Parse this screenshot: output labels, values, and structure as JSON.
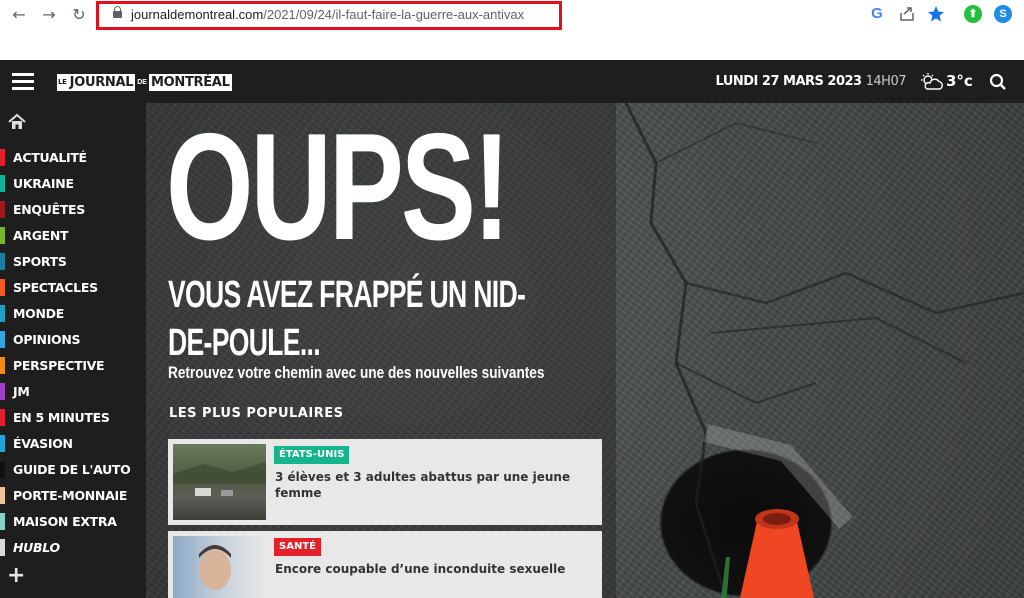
{
  "browser": {
    "url_domain": "journaldemontreal.com",
    "url_path": "/2021/09/24/il-faut-faire-la-guerre-aux-antivax"
  },
  "header": {
    "logo_le": "LE",
    "logo_journal": "JOURNAL",
    "logo_de": "DE",
    "logo_montreal": "MONTRÉAL",
    "date": "LUNDI 27 MARS 2023",
    "time": "14H07",
    "temperature": "3°c"
  },
  "sidebar": {
    "items": [
      {
        "label": "ACTUALITÉ",
        "color": "#e4202a"
      },
      {
        "label": "UKRAINE",
        "color": "#0fb49a"
      },
      {
        "label": "ENQUÊTES",
        "color": "#9b1b1f"
      },
      {
        "label": "ARGENT",
        "color": "#7bb52a"
      },
      {
        "label": "SPORTS",
        "color": "#1a7fa6"
      },
      {
        "label": "SPECTACLES",
        "color": "#f25c20"
      },
      {
        "label": "MONDE",
        "color": "#1da0c8"
      },
      {
        "label": "OPINIONS",
        "color": "#31a8e0"
      },
      {
        "label": "PERSPECTIVE",
        "color": "#f28a1a"
      },
      {
        "label": "JM",
        "color": "#a040c8"
      },
      {
        "label": "EN 5 MINUTES",
        "color": "#e4202a"
      },
      {
        "label": "ÉVASION",
        "color": "#1fa6d8"
      },
      {
        "label": "GUIDE DE L'AUTO",
        "color": "#111111"
      },
      {
        "label": "PORTE-MONNAIE",
        "color": "#f0c49a"
      },
      {
        "label": "MAISON EXTRA",
        "color": "#86d0c8"
      },
      {
        "label": "HUBLO",
        "color": "#d8d8d8"
      }
    ]
  },
  "hero": {
    "title": "OUPS!",
    "subtitle": "VOUS AVEZ FRAPPÉ UN NID-DE-POULE...",
    "lead": "Retrouvez votre chemin avec une des nouvelles suivantes",
    "popular_title": "LES PLUS POPULAIRES",
    "cards": [
      {
        "tag": "ÉTATS-UNIS",
        "tag_color": "#14b48c",
        "headline": "3 élèves et 3 adultes abattus par une jeune femme"
      },
      {
        "tag": "SANTÉ",
        "tag_color": "#e4202a",
        "headline": "Encore coupable d’une inconduite sexuelle"
      }
    ]
  }
}
